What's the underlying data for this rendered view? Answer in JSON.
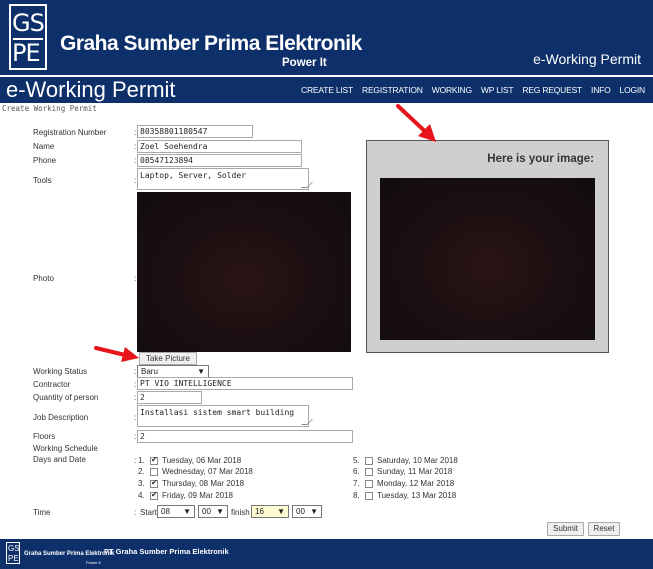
{
  "header": {
    "logo_line1": "GS",
    "logo_line2": "PE",
    "brand": "Graha Sumber Prima Elektronik",
    "tagline": "Power It",
    "app_title": "e-Working Permit"
  },
  "nav": {
    "title": "e-Working Permit",
    "items": [
      "CREATE LIST",
      "REGISTRATION",
      "WORKING",
      "WP LIST",
      "REG REQUEST",
      "INFO",
      "LOGIN"
    ]
  },
  "breadcrumb": "Create Working Permit",
  "form": {
    "labels": {
      "registration_number": "Registration Number",
      "name": "Name",
      "phone": "Phone",
      "tools": "Tools",
      "photo": "Photo",
      "working_status": "Working Status",
      "contractor": "Contractor",
      "quantity": "Quantity of person",
      "job_description": "Job Description",
      "floors": "Floors",
      "schedule_line1": "Working Schedule",
      "schedule_line2": "Days and Date",
      "time": "Time"
    },
    "values": {
      "registration_number": "80358801180547",
      "name": "Zoel Soehendra",
      "phone": "08547123894",
      "tools": "Laptop, Server, Solder",
      "working_status": "Baru",
      "contractor": "PT VIO INTELLIGENCE",
      "quantity": "2",
      "job_description": "Installasi sistem smart building",
      "floors": "2"
    },
    "take_picture": "Take Picture",
    "days": [
      {
        "num": "1.",
        "label": "Tuesday, 06 Mar 2018",
        "checked": true
      },
      {
        "num": "2.",
        "label": "Wednesday, 07 Mar 2018",
        "checked": false
      },
      {
        "num": "3.",
        "label": "Thursday, 08 Mar 2018",
        "checked": true
      },
      {
        "num": "4.",
        "label": "Friday, 09 Mar 2018",
        "checked": true
      },
      {
        "num": "5.",
        "label": "Saturday, 10 Mar 2018",
        "checked": false
      },
      {
        "num": "6.",
        "label": "Sunday, 11 Mar 2018",
        "checked": false
      },
      {
        "num": "7.",
        "label": "Monday, 12 Mar 2018",
        "checked": false
      },
      {
        "num": "8.",
        "label": "Tuesday, 13 Mar 2018",
        "checked": false
      }
    ],
    "time": {
      "start_label": "Start",
      "start_hour": "08",
      "start_minute": "00",
      "finish_label": "finish",
      "finish_hour": "16",
      "finish_minute": "00"
    },
    "submit": "Submit",
    "reset": "Reset"
  },
  "panel": {
    "title": "Here is your image:"
  },
  "footer": {
    "logo_line1": "GS",
    "logo_line2": "PE",
    "brand": "Graha Sumber Prima Elektronik",
    "tagline": "Power It",
    "company": "PT Graha Sumber Prima Elektronik"
  },
  "colors": {
    "brand_navy": "#0d2f6a",
    "panel_gray": "#cfcfcf",
    "annotation_red": "#e8141b"
  }
}
